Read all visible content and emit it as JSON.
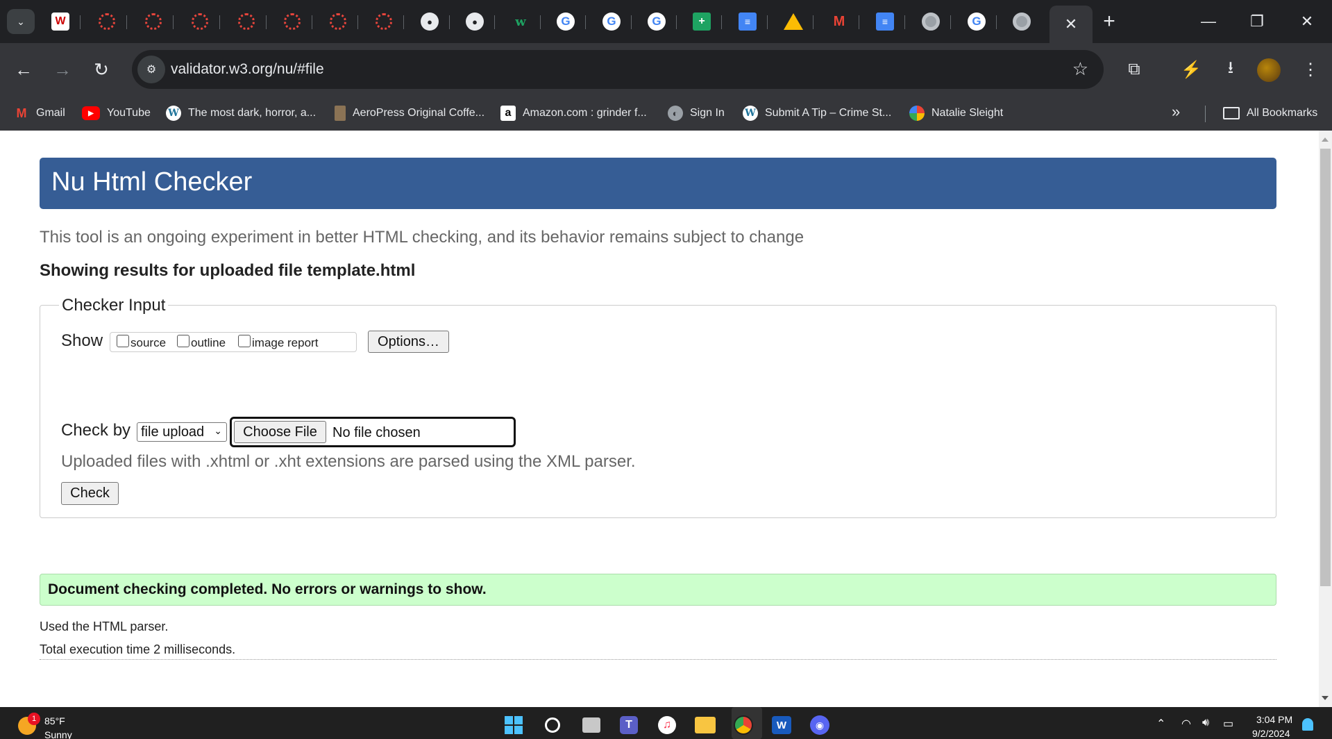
{
  "browser": {
    "tabs": [
      {
        "icon": "wiley-icon"
      },
      {
        "icon": "red-gear-icon"
      },
      {
        "icon": "red-gear-icon"
      },
      {
        "icon": "red-gear-icon"
      },
      {
        "icon": "red-gear-icon"
      },
      {
        "icon": "red-gear-icon"
      },
      {
        "icon": "red-gear-icon"
      },
      {
        "icon": "red-gear-icon"
      },
      {
        "icon": "github-icon"
      },
      {
        "icon": "github-icon"
      },
      {
        "icon": "w-green-icon"
      },
      {
        "icon": "google-icon"
      },
      {
        "icon": "google-icon"
      },
      {
        "icon": "google-icon"
      },
      {
        "icon": "google-sheets-icon"
      },
      {
        "icon": "google-docs-icon"
      },
      {
        "icon": "google-drive-icon"
      },
      {
        "icon": "gmail-icon"
      },
      {
        "icon": "google-docs-icon"
      },
      {
        "icon": "chrome-icon"
      },
      {
        "icon": "google-icon"
      },
      {
        "icon": "chrome-icon"
      },
      {
        "icon": "close-icon",
        "active": true
      }
    ],
    "url": "validator.w3.org/nu/#file",
    "bookmarks": [
      {
        "label": "Gmail",
        "icon": "gmail-icon"
      },
      {
        "label": "YouTube",
        "icon": "youtube-icon"
      },
      {
        "label": "The most dark, horror, a...",
        "icon": "wordpress-icon"
      },
      {
        "label": "AeroPress Original Coffe...",
        "icon": "aeropress-icon"
      },
      {
        "label": "Amazon.com : grinder f...",
        "icon": "amazon-icon"
      },
      {
        "label": "Sign In",
        "icon": "globe-icon"
      },
      {
        "label": "Submit A Tip – Crime St...",
        "icon": "wordpress-icon"
      },
      {
        "label": "Natalie Sleight",
        "icon": "pinwheel-icon"
      }
    ],
    "all_bookmarks_label": "All Bookmarks"
  },
  "page": {
    "title": "Nu Html Checker",
    "subtitle": "This tool is an ongoing experiment in better HTML checking, and its behavior remains subject to change",
    "results_heading": "Showing results for uploaded file template.html",
    "checker": {
      "legend": "Checker Input",
      "show_label": "Show",
      "options": [
        {
          "label": "source",
          "checked": false
        },
        {
          "label": "outline",
          "checked": false
        },
        {
          "label": "image report",
          "checked": false
        }
      ],
      "options_button": "Options…",
      "check_by_label": "Check by",
      "check_by_value": "file upload",
      "choose_file_button": "Choose File",
      "file_status": "No file chosen",
      "upload_note": "Uploaded files with .xhtml or .xht extensions are parsed using the XML parser.",
      "check_button": "Check"
    },
    "success_message": "Document checking completed. No errors or warnings to show.",
    "parser_info": "Used the HTML parser.",
    "execution_time": "Total execution time 2 milliseconds."
  },
  "taskbar": {
    "weather_temp": "85°F",
    "weather_condition": "Sunny",
    "weather_badge": "1",
    "time": "3:04 PM",
    "date": "9/2/2024"
  },
  "colors": {
    "header_bar": "#365d95",
    "success_bg": "#ccffcc",
    "chrome_dark": "#202124",
    "chrome_toolbar": "#35363a"
  }
}
